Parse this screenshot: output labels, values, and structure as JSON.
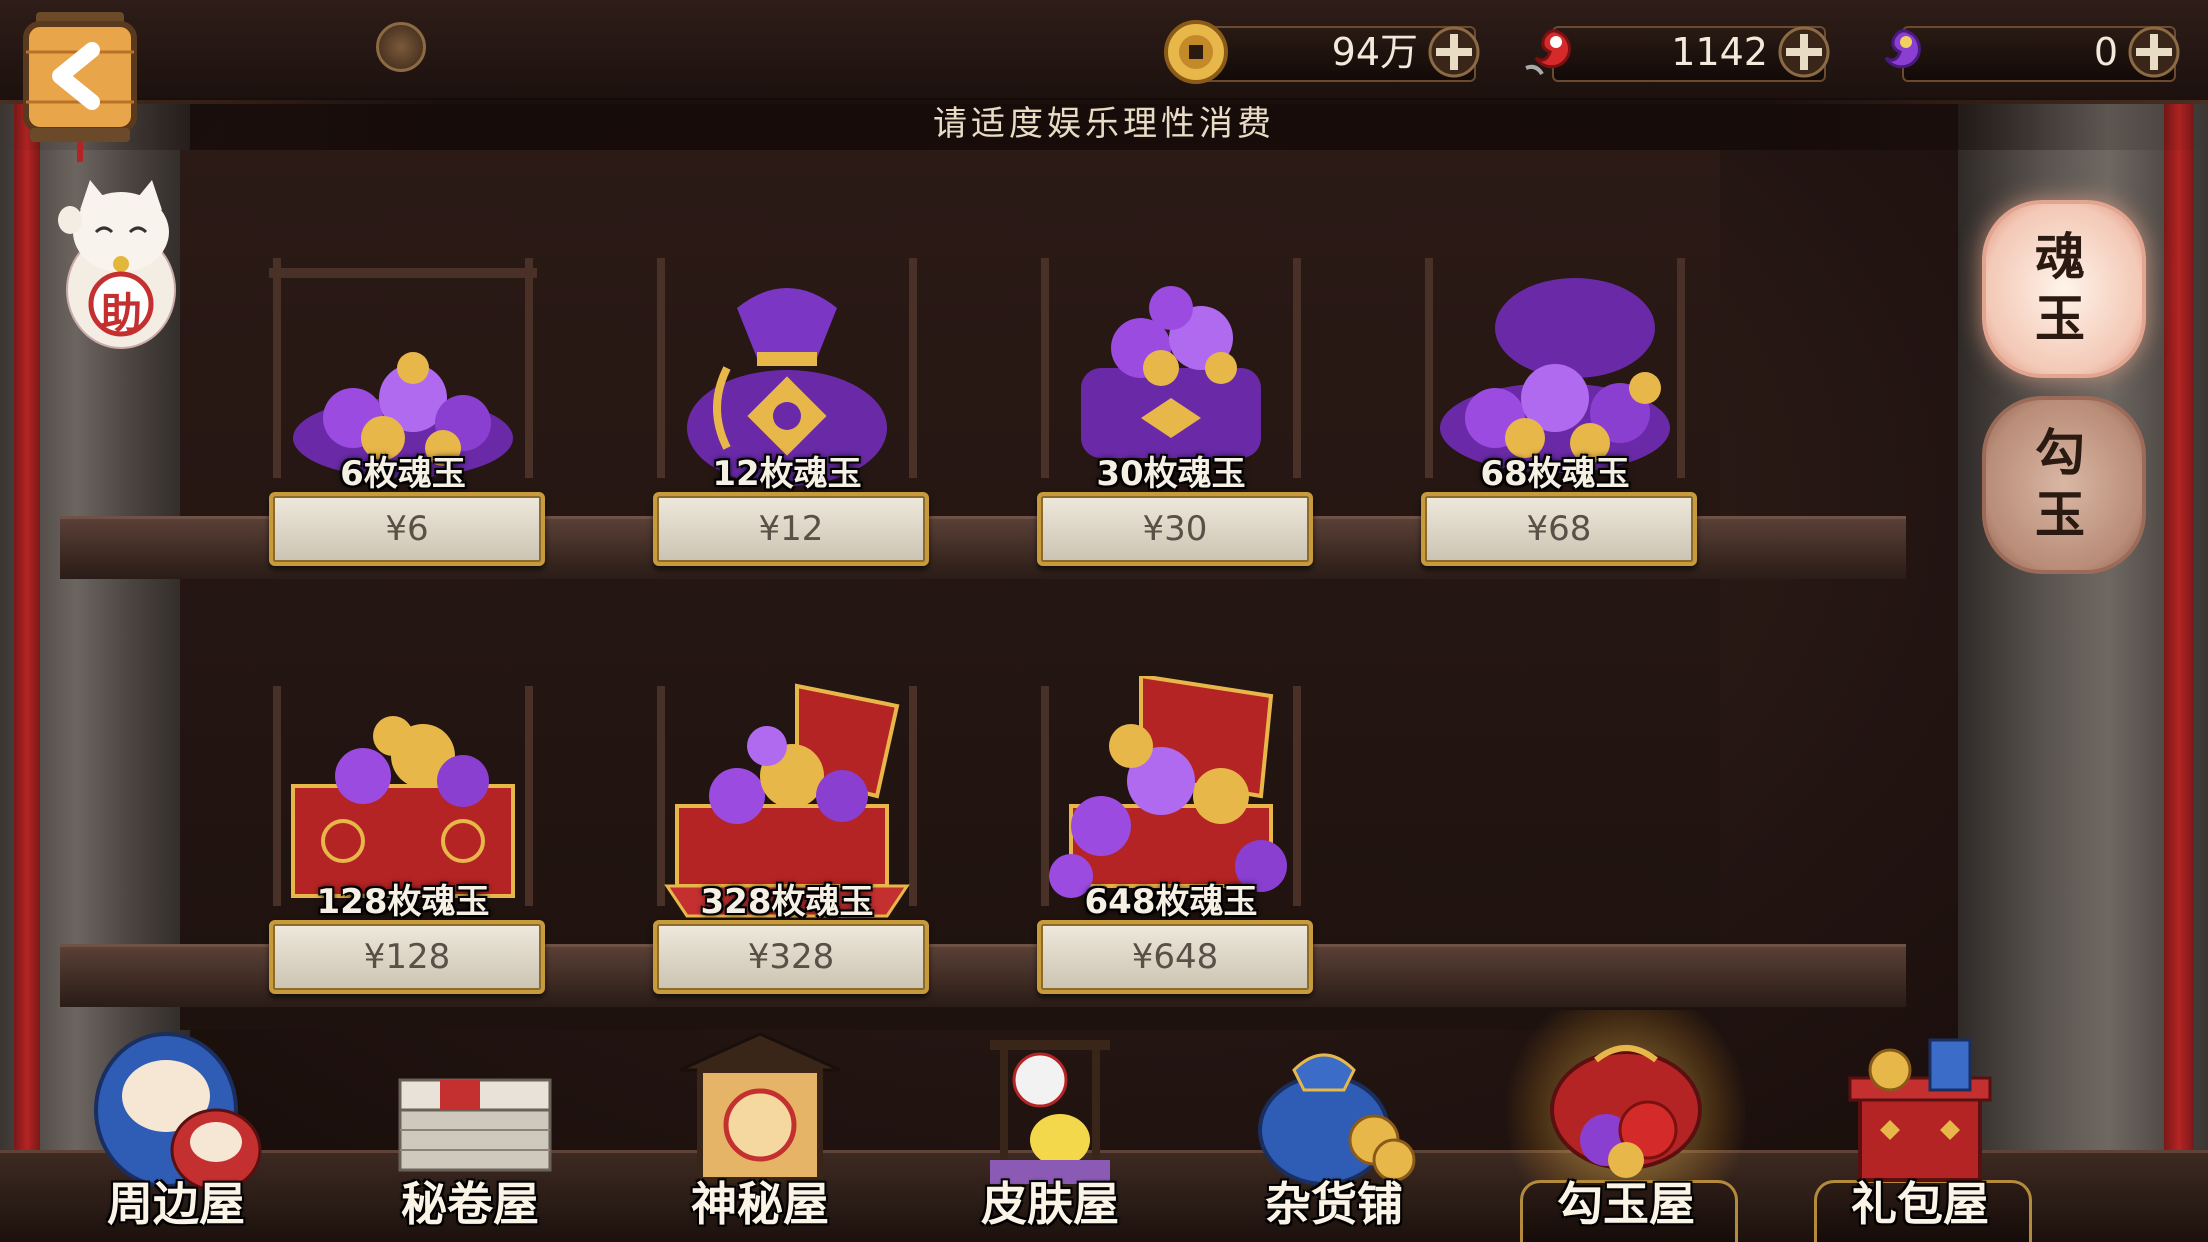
{
  "header": {
    "notice": "请适度娱乐理性消费",
    "currencies": [
      {
        "name": "gold-coin",
        "value": "94万"
      },
      {
        "name": "magatama",
        "value": "1142"
      },
      {
        "name": "soul-jade",
        "value": "0"
      }
    ]
  },
  "helper": {
    "label": "助"
  },
  "products": [
    {
      "name": "6枚魂玉",
      "price": "¥6"
    },
    {
      "name": "12枚魂玉",
      "price": "¥12"
    },
    {
      "name": "30枚魂玉",
      "price": "¥30"
    },
    {
      "name": "68枚魂玉",
      "price": "¥68"
    },
    {
      "name": "128枚魂玉",
      "price": "¥128"
    },
    {
      "name": "328枚魂玉",
      "price": "¥328"
    },
    {
      "name": "648枚魂玉",
      "price": "¥648"
    }
  ],
  "side_tabs": [
    {
      "label": "魂玉",
      "active": true
    },
    {
      "label": "勾玉",
      "active": false
    }
  ],
  "bottom_nav": [
    {
      "label": "周边屋",
      "active": false
    },
    {
      "label": "秘卷屋",
      "active": false
    },
    {
      "label": "神秘屋",
      "active": false
    },
    {
      "label": "皮肤屋",
      "active": false
    },
    {
      "label": "杂货铺",
      "active": false
    },
    {
      "label": "勾玉屋",
      "active": true
    },
    {
      "label": "礼包屋",
      "active": false
    }
  ],
  "colors": {
    "accent_gold": "#c79a3c",
    "soul_jade_purple": "#8a3fd0",
    "magatama_red": "#d42a2a"
  }
}
